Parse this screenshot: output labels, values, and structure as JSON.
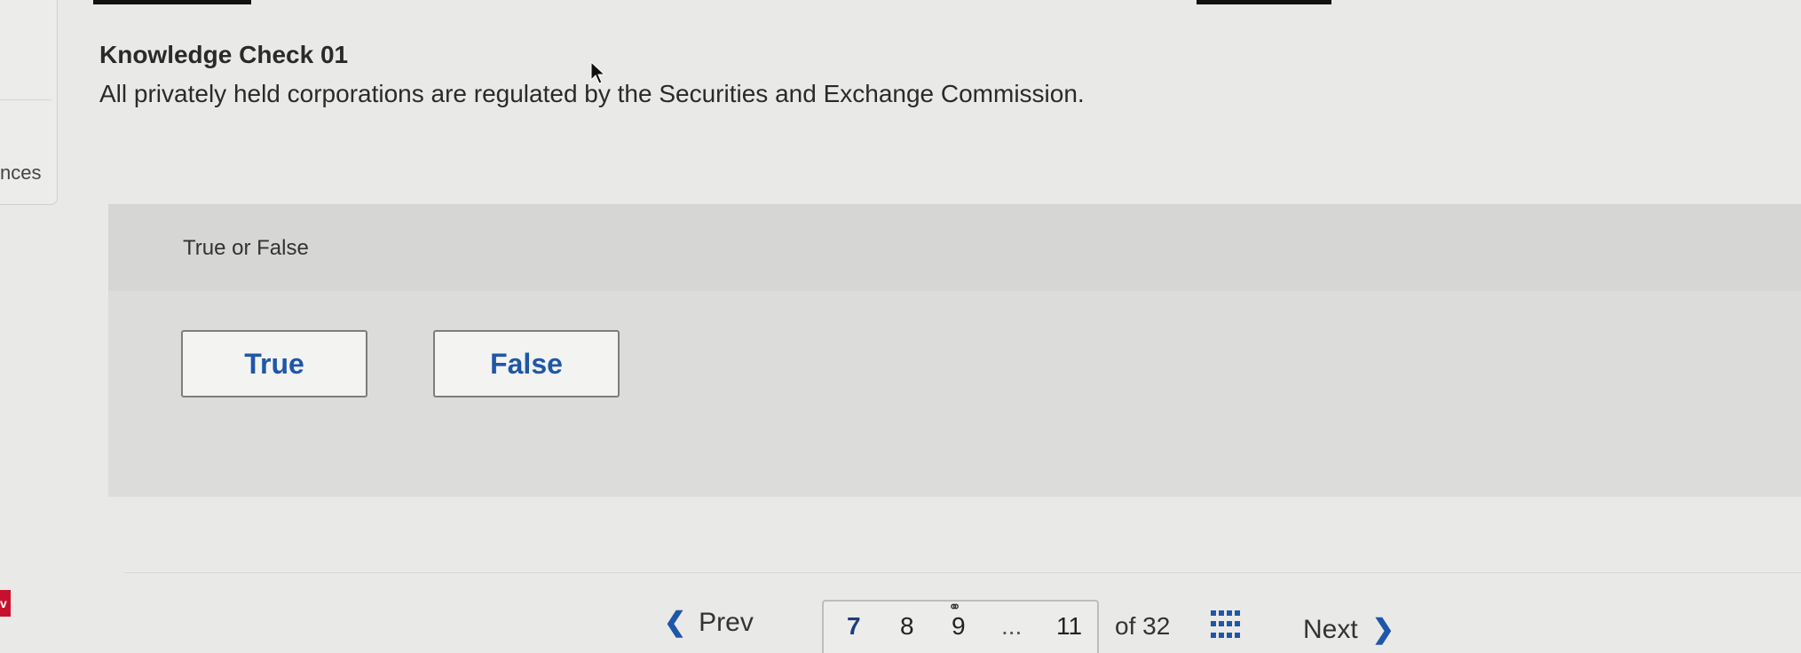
{
  "side_panel": {
    "label": "nces",
    "badge": "v"
  },
  "header": {
    "title": "Knowledge Check 01",
    "question": "All privately held corporations are regulated by the Securities and Exchange Commission."
  },
  "answer": {
    "type_label": "True or False",
    "choices": [
      {
        "label": "True"
      },
      {
        "label": "False"
      }
    ]
  },
  "nav": {
    "prev_label": "Prev",
    "next_label": "Next",
    "pages": [
      "7",
      "8",
      "9",
      "...",
      "11"
    ],
    "current_page": "7",
    "of_total": "of 32",
    "icons": {
      "prev": "chevron-left-icon",
      "next": "chevron-right-icon",
      "grid": "grid-icon",
      "link": "link-icon"
    }
  },
  "colors": {
    "accent": "#1f57a8",
    "badge": "#c8102e"
  }
}
